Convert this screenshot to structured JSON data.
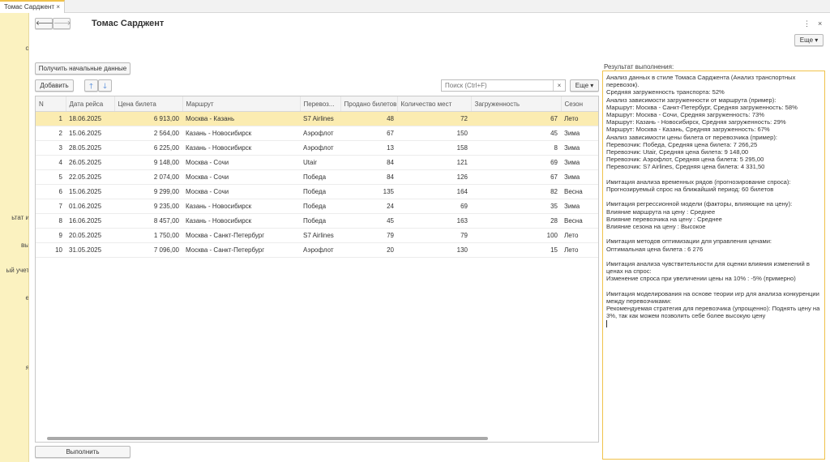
{
  "tab": {
    "title": "Томас Сарджент",
    "close": "×"
  },
  "sidebar": {
    "items": [
      "о",
      "ьтат и",
      "вы",
      "ый учет",
      "е",
      "я"
    ]
  },
  "nav": {
    "back": "🡐",
    "forward": "🡒"
  },
  "page_title": "Томас Сарджент",
  "top_icons": {
    "more": "⋮",
    "close": "×"
  },
  "more_button": "Еще ▾",
  "load_button": "Получить начальные данные",
  "toolbar": {
    "add": "Добавить",
    "up": "🡑",
    "down": "🡓",
    "more": "Еще ▾"
  },
  "search": {
    "placeholder": "Поиск (Ctrl+F)",
    "clear": "×"
  },
  "table": {
    "columns": [
      "N",
      "Дата рейса",
      "Цена билета",
      "Маршрут",
      "Перевоз...",
      "Продано билетов",
      "Количество мест",
      "Загруженность",
      "Сезон"
    ],
    "rows": [
      [
        "1",
        "18.06.2025",
        "6 913,00",
        "Москва - Казань",
        "S7 Airlines",
        "48",
        "72",
        "67",
        "Лето"
      ],
      [
        "2",
        "15.06.2025",
        "2 564,00",
        "Казань - Новосибирск",
        "Аэрофлот",
        "67",
        "150",
        "45",
        "Зима"
      ],
      [
        "3",
        "28.05.2025",
        "6 225,00",
        "Казань - Новосибирск",
        "Аэрофлот",
        "13",
        "158",
        "8",
        "Зима"
      ],
      [
        "4",
        "26.05.2025",
        "9 148,00",
        "Москва - Сочи",
        "Utair",
        "84",
        "121",
        "69",
        "Зима"
      ],
      [
        "5",
        "22.05.2025",
        "2 074,00",
        "Москва - Сочи",
        "Победа",
        "84",
        "126",
        "67",
        "Зима"
      ],
      [
        "6",
        "15.06.2025",
        "9 299,00",
        "Москва - Сочи",
        "Победа",
        "135",
        "164",
        "82",
        "Весна"
      ],
      [
        "7",
        "01.06.2025",
        "9 235,00",
        "Казань - Новосибирск",
        "Победа",
        "24",
        "69",
        "35",
        "Зима"
      ],
      [
        "8",
        "16.06.2025",
        "8 457,00",
        "Казань - Новосибирск",
        "Победа",
        "45",
        "163",
        "28",
        "Весна"
      ],
      [
        "9",
        "20.05.2025",
        "1 750,00",
        "Москва - Санкт-Петербург",
        "S7 Airlines",
        "79",
        "79",
        "100",
        "Лето"
      ],
      [
        "10",
        "31.05.2025",
        "7 096,00",
        "Москва - Санкт-Петербург",
        "Аэрофлот",
        "20",
        "130",
        "15",
        "Лето"
      ]
    ]
  },
  "run_button": "Выполнить",
  "result": {
    "label": "Результат выполнения:",
    "lines": [
      "Анализ данных в стиле Томаса Сарджента (Анализ транспортных",
      "перевозок).",
      "Средняя загруженность транспорта: 52%",
      "Анализ зависимости загруженности от маршрута (пример):",
      "Маршрут: Москва - Санкт-Петербург, Средняя загруженность: 58%",
      "Маршрут: Москва - Сочи, Средняя загруженность: 73%",
      "Маршрут: Казань - Новосибирск, Средняя загруженность: 29%",
      "Маршрут: Москва - Казань, Средняя загруженность: 67%",
      "Анализ зависимости цены билета от перевозчика (пример):",
      "Перевозчик: Победа, Средняя цена билета: 7 266,25",
      "Перевозчик: Utair, Средняя цена билета: 9 148,00",
      "Перевозчик: Аэрофлот, Средняя цена билета: 5 295,00",
      "Перевозчик: S7 Airlines, Средняя цена билета: 4 331,50",
      "",
      "Имитация анализа временных рядов (прогнозирование спроса):",
      "Прогнозируемый спрос на ближайший период: 60 билетов",
      "",
      "Имитация регрессионной модели (факторы, влияющие на цену):",
      "Влияние маршрута на цену : Среднее",
      "Влияние перевозчика на цену : Среднее",
      "Влияние сезона на цену : Высокое",
      "",
      "Имитация методов оптимизации для управления ценами:",
      "Оптимальная цена билета : 6 276",
      "",
      "Имитация анализа чувствительности для оценки влияния изменений в",
      "ценах на спрос:",
      "Изменение спроса при увеличении цены на 10% : -5% (примерно)",
      "",
      "Имитация моделирования на основе теории игр для анализа конкуренции",
      "между перевозчиками:",
      "Рекомендуемая стратегия для перевозчика (упрощенно): Поднять цену на",
      "3%, так как можем позволить себе более высокую цену"
    ]
  },
  "colors": {
    "accent": "#f0c24b",
    "selected_row": "#fbecb1",
    "sidebar": "#fbf2c0",
    "arrow": "#3a7ad5"
  }
}
